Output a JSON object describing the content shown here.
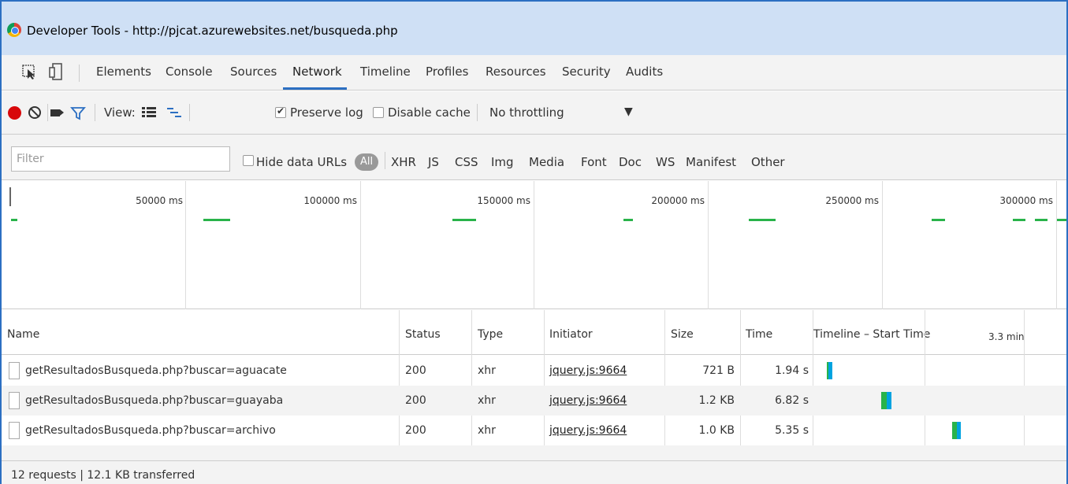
{
  "window": {
    "title": "Developer Tools - http://pjcat.azurewebsites.net/busqueda.php",
    "accent_color": "#2c6fc2"
  },
  "tabs": [
    {
      "label": "Elements"
    },
    {
      "label": "Console"
    },
    {
      "label": "Sources"
    },
    {
      "label": "Network",
      "active": true
    },
    {
      "label": "Timeline"
    },
    {
      "label": "Profiles"
    },
    {
      "label": "Resources"
    },
    {
      "label": "Security"
    },
    {
      "label": "Audits"
    }
  ],
  "toolbar": {
    "view_label": "View:",
    "preserve_log_label": "Preserve log",
    "preserve_log_checked": true,
    "disable_cache_label": "Disable cache",
    "disable_cache_checked": false,
    "throttling_value": "No throttling",
    "dropdown_arrow": "▼",
    "record_color": "#d8080a"
  },
  "filterbar": {
    "filter_placeholder": "Filter",
    "hide_data_urls_label": "Hide data URLs",
    "all_label": "All",
    "types": [
      "XHR",
      "JS",
      "CSS",
      "Img",
      "Media",
      "Font",
      "Doc",
      "WS",
      "Manifest",
      "Other"
    ]
  },
  "overview": {
    "ticks": [
      "50000 ms",
      "100000 ms",
      "150000 ms",
      "200000 ms",
      "250000 ms",
      "300000 ms"
    ],
    "bar_color": "#29b34a"
  },
  "table": {
    "headers": {
      "name": "Name",
      "status": "Status",
      "type": "Type",
      "initiator": "Initiator",
      "size": "Size",
      "time": "Time",
      "timeline": "Timeline – Start Time",
      "timeline_tick": "3.3 min"
    },
    "rows": [
      {
        "name": "getResultadosBusqueda.php?buscar=aguacate",
        "status": "200",
        "type": "xhr",
        "initiator": "jquery.js:9664",
        "size": "721 B",
        "time": "1.94 s"
      },
      {
        "name": "getResultadosBusqueda.php?buscar=guayaba",
        "status": "200",
        "type": "xhr",
        "initiator": "jquery.js:9664",
        "size": "1.2 KB",
        "time": "6.82 s"
      },
      {
        "name": "getResultadosBusqueda.php?buscar=archivo",
        "status": "200",
        "type": "xhr",
        "initiator": "jquery.js:9664",
        "size": "1.0 KB",
        "time": "5.35 s"
      }
    ]
  },
  "status": {
    "summary": "12 requests  |  12.1 KB transferred"
  }
}
